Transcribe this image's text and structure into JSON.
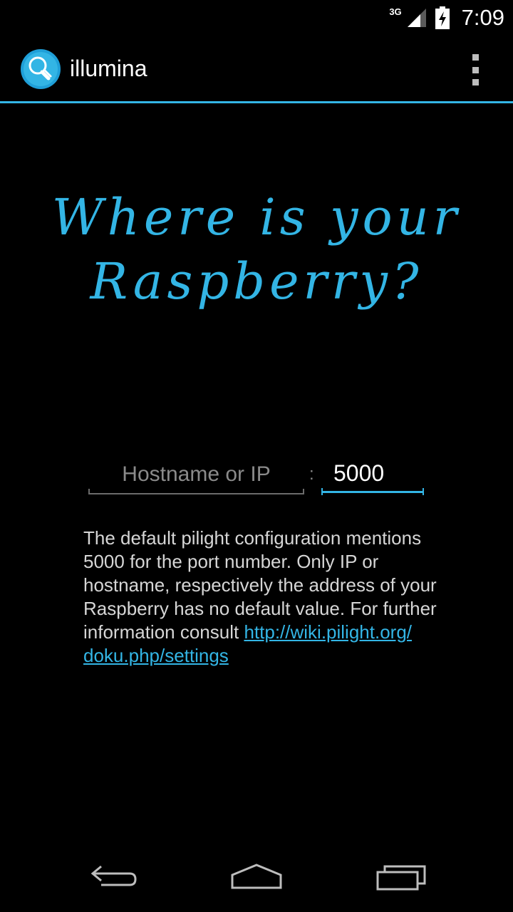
{
  "status_bar": {
    "network": "3G",
    "time": "7:09"
  },
  "action_bar": {
    "title": "illumina",
    "app_icon": "lightbulb-icon",
    "overflow_icon": "overflow-menu-icon"
  },
  "hero": {
    "line1": "Where is your",
    "line2": "Raspberry?"
  },
  "form": {
    "host_placeholder": "Hostname or IP",
    "host_value": "",
    "separator": ":",
    "port_value": "5000"
  },
  "help": {
    "text": "The default pilight configuration mentions 5000 for the port number. Only IP or hostname, respectively the address of your Raspberry has no default value. For further information consult ",
    "link": "http://wiki.pilight.org/​doku.php/settings"
  },
  "nav_bar": {
    "back_icon": "back-icon",
    "home_icon": "home-icon",
    "recents_icon": "recent-apps-icon"
  },
  "colors": {
    "accent": "#33b5e5",
    "background": "#000000"
  }
}
